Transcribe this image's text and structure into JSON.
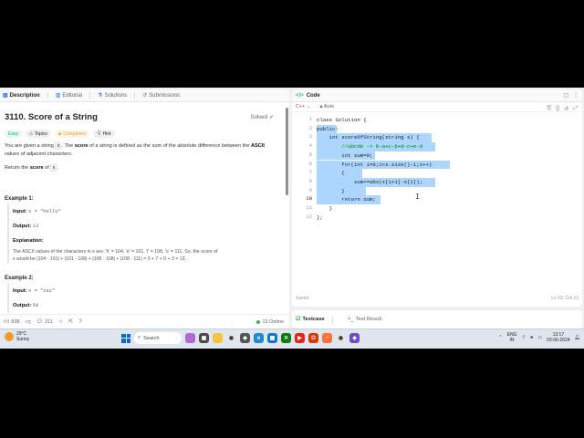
{
  "left_panel": {
    "tabs": [
      {
        "label": "Description",
        "icon": "document-icon"
      },
      {
        "label": "Editorial",
        "icon": "book-icon"
      },
      {
        "label": "Solutions",
        "icon": "flask-icon"
      },
      {
        "label": "Submissions",
        "icon": "history-icon"
      }
    ],
    "title": "3110. Score of a String",
    "status": "Solved",
    "chips": {
      "difficulty": "Easy",
      "topics": "Topics",
      "companies": "Companies",
      "hint": "Hint"
    },
    "description": {
      "p1_a": "You are given a string ",
      "p1_code": "s",
      "p1_b": ". The ",
      "p1_bold": "score",
      "p1_c": " of a string is defined as the sum of the absolute difference between the ",
      "p1_bold2": "ASCII",
      "p1_d": " values of adjacent characters.",
      "p2_a": "Return the ",
      "p2_bold": "score",
      "p2_b": " of ",
      "p2_code": "s",
      "p2_c": "."
    },
    "example1": {
      "title": "Example 1:",
      "input_label": "Input:",
      "input_value": "s = \"hello\"",
      "output_label": "Output:",
      "output_value": "13",
      "explanation_label": "Explanation:",
      "explanation_1": "The ASCII values of the characters in s are: 'h' = 104, 'e' = 101, 'l' = 108, 'o' = 111. So, the score of",
      "explanation_2": "s would be |104 - 101| + |101 - 108| + |108 - 108| + |108 - 111| = 3 + 7 + 0 + 3 = 13."
    },
    "example2": {
      "title": "Example 2:",
      "input_label": "Input:",
      "input_value": "s = \"zaz\"",
      "output_label": "Output:",
      "output_value": "50"
    },
    "footer": {
      "likes": "838",
      "comments": "211",
      "online": "13 Online"
    }
  },
  "editor": {
    "header": "Code",
    "language": "C++",
    "mode": "Auto",
    "status_left": "Saved",
    "status_right": "Ln 10, Col 22",
    "lines": [
      "class Solution {",
      "public:",
      "    int scoreOfString(string s) {",
      "        //abcde -> b-a+c-b+d-c+e-d",
      "        int sum=0;",
      "        for(int i=0;i<s.size()-1;i++)",
      "        {",
      "            sum+=abs(s[i+1]-s[i]);",
      "        }",
      "        return sum;",
      "    }",
      "};"
    ],
    "line_numbers": [
      "1",
      "2",
      "3",
      "4",
      "5",
      "6",
      "7",
      "8",
      "9",
      "10",
      "11",
      "12"
    ]
  },
  "test_panel": {
    "testcase": "Testcase",
    "test_result": "Test Result"
  },
  "taskbar": {
    "temperature": "29°C",
    "weather": "Sunny",
    "search": "Search",
    "lang_1": "ENG",
    "lang_2": "IN",
    "time": "13:17",
    "date": "03-06-2024"
  }
}
